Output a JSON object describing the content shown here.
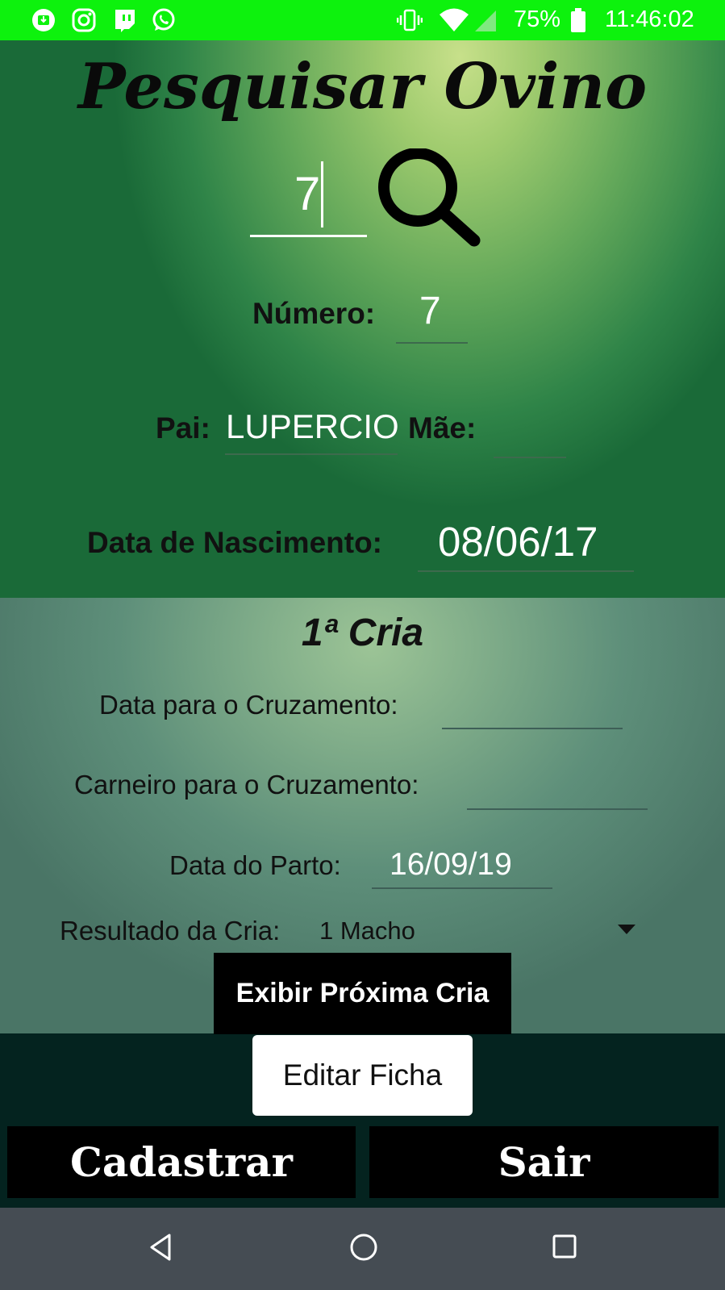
{
  "status_bar": {
    "battery_percent": "75%",
    "time": "11:46:02",
    "notification_icons": [
      "download-icon",
      "instagram-icon",
      "twitch-icon",
      "whatsapp-icon"
    ],
    "system_icons": [
      "vibrate-icon",
      "wifi-icon",
      "signal-icon",
      "battery-icon"
    ],
    "background_color": "#0df20d"
  },
  "header": {
    "title": "Pesquisar Ovino"
  },
  "search": {
    "value": "7",
    "icon": "search-icon"
  },
  "fields": {
    "numero_label": "Número:",
    "numero_value": "7",
    "pai_label": "Pai:",
    "pai_value": "LUPERCIO",
    "mae_label": "Mãe:",
    "mae_value": "",
    "nascimento_label": "Data de Nascimento:",
    "nascimento_value": "08/06/17"
  },
  "cria": {
    "title": "1ª Cria",
    "cruzamento_label": "Data para o Cruzamento:",
    "cruzamento_value": "",
    "carneiro_label": "Carneiro para o Cruzamento:",
    "carneiro_value": "",
    "parto_label": "Data do Parto:",
    "parto_value": "16/09/19",
    "resultado_label": "Resultado da Cria:",
    "resultado_value": "1 Macho"
  },
  "buttons": {
    "next_cria": "Exibir Próxima Cria",
    "edit": "Editar Ficha",
    "register": "Cadastrar",
    "exit": "Sair"
  },
  "navbar": {
    "icons": [
      "back-icon",
      "home-icon",
      "recents-icon"
    ]
  }
}
